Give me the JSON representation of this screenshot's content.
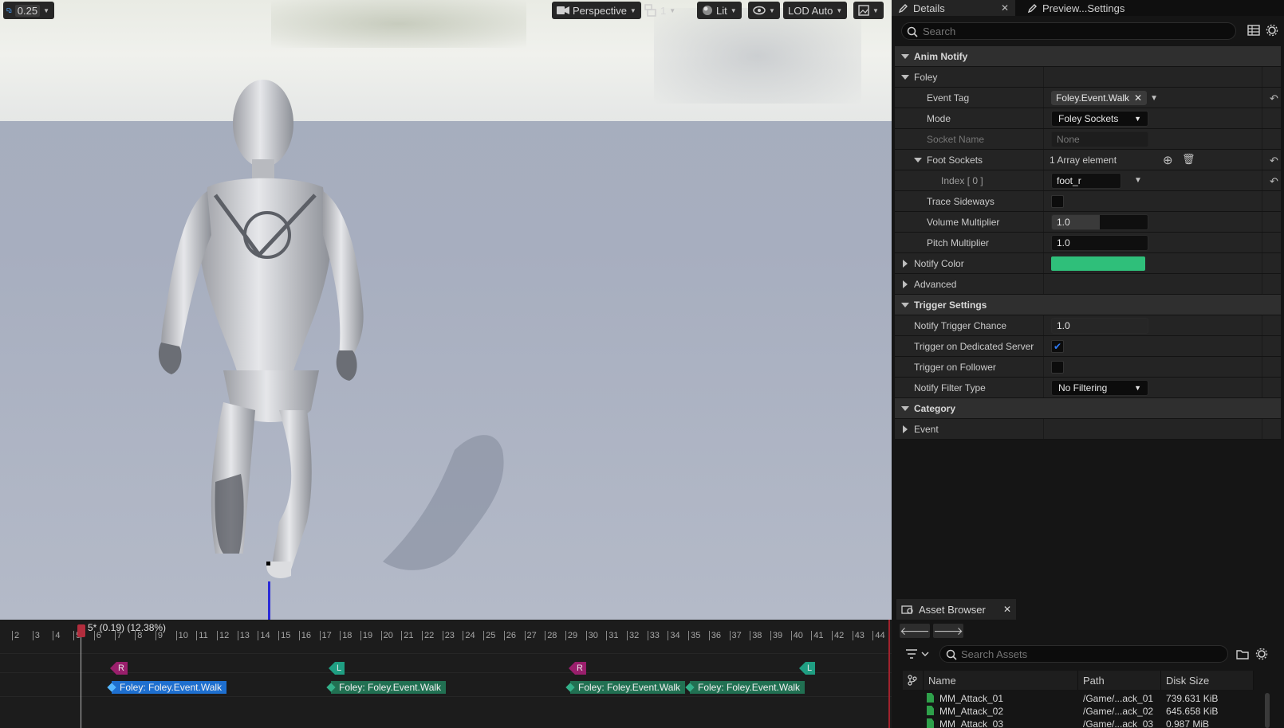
{
  "viewport": {
    "speed": "0.25",
    "camera_mode": "Perspective",
    "layout_count": "1",
    "view_mode": "Lit",
    "lod": "LOD Auto"
  },
  "timeline": {
    "playhead_label": "5* (0.19) (12.38%)",
    "ticks": [
      "2",
      "3",
      "4",
      "5",
      "6",
      "7",
      "8",
      "9",
      "10",
      "11",
      "12",
      "13",
      "14",
      "15",
      "16",
      "17",
      "18",
      "19",
      "20",
      "21",
      "22",
      "23",
      "24",
      "25",
      "26",
      "27",
      "28",
      "29",
      "30",
      "31",
      "32",
      "33",
      "34",
      "35",
      "36",
      "37",
      "38",
      "39",
      "40",
      "41",
      "42",
      "43",
      "44"
    ],
    "sync_markers": [
      {
        "label": "R",
        "side": "R"
      },
      {
        "label": "L",
        "side": "L"
      },
      {
        "label": "R",
        "side": "R"
      },
      {
        "label": "L",
        "side": "L"
      }
    ],
    "notifies": [
      {
        "label": "Foley: Foley.Event.Walk",
        "color": "#1e6fcf"
      },
      {
        "label": "Foley: Foley.Event.Walk",
        "color": "#217052"
      },
      {
        "label": "Foley: Foley.Event.Walk",
        "color": "#217052"
      },
      {
        "label": "Foley: Foley.Event.Walk",
        "color": "#217052"
      }
    ]
  },
  "details": {
    "tabs": [
      {
        "label": "Details",
        "icon": "pencil-icon"
      },
      {
        "label": "Preview...Settings",
        "icon": "pencil-icon"
      }
    ],
    "search_placeholder": "Search",
    "categories": {
      "anim_notify": "Anim Notify",
      "foley": "Foley",
      "trigger_settings": "Trigger Settings",
      "category": "Category"
    },
    "props": {
      "event_tag": {
        "label": "Event Tag",
        "value": "Foley.Event.Walk"
      },
      "mode": {
        "label": "Mode",
        "value": "Foley Sockets"
      },
      "socket_name": {
        "label": "Socket Name",
        "value": "None"
      },
      "foot_sockets": {
        "label": "Foot Sockets",
        "value": "1 Array element"
      },
      "index0": {
        "label": "Index [ 0 ]",
        "value": "foot_r"
      },
      "trace_sideways": {
        "label": "Trace Sideways",
        "checked": false
      },
      "volume_multiplier": {
        "label": "Volume Multiplier",
        "value": "1.0",
        "fill": 0.5
      },
      "pitch_multiplier": {
        "label": "Pitch Multiplier",
        "value": "1.0"
      },
      "notify_color": {
        "label": "Notify Color",
        "color": "#2fbf7a"
      },
      "advanced": {
        "label": "Advanced"
      },
      "notify_trigger_chance": {
        "label": "Notify Trigger Chance",
        "value": "1.0"
      },
      "trigger_on_dedicated_server": {
        "label": "Trigger on Dedicated Server",
        "checked": true
      },
      "trigger_on_follower": {
        "label": "Trigger on Follower",
        "checked": false
      },
      "notify_filter_type": {
        "label": "Notify Filter Type",
        "value": "No Filtering"
      },
      "event": {
        "label": "Event"
      }
    }
  },
  "asset_browser": {
    "title": "Asset Browser",
    "search_placeholder": "Search Assets",
    "columns": [
      "Name",
      "Path",
      "Disk Size"
    ],
    "rows": [
      {
        "name": "MM_Attack_01",
        "path": "/Game/...ack_01",
        "size": "739.631 KiB"
      },
      {
        "name": "MM_Attack_02",
        "path": "/Game/...ack_02",
        "size": "645.658 KiB"
      },
      {
        "name": "MM_Attack_03",
        "path": "/Game/...ack_03",
        "size": "0.987 MiB"
      }
    ]
  }
}
